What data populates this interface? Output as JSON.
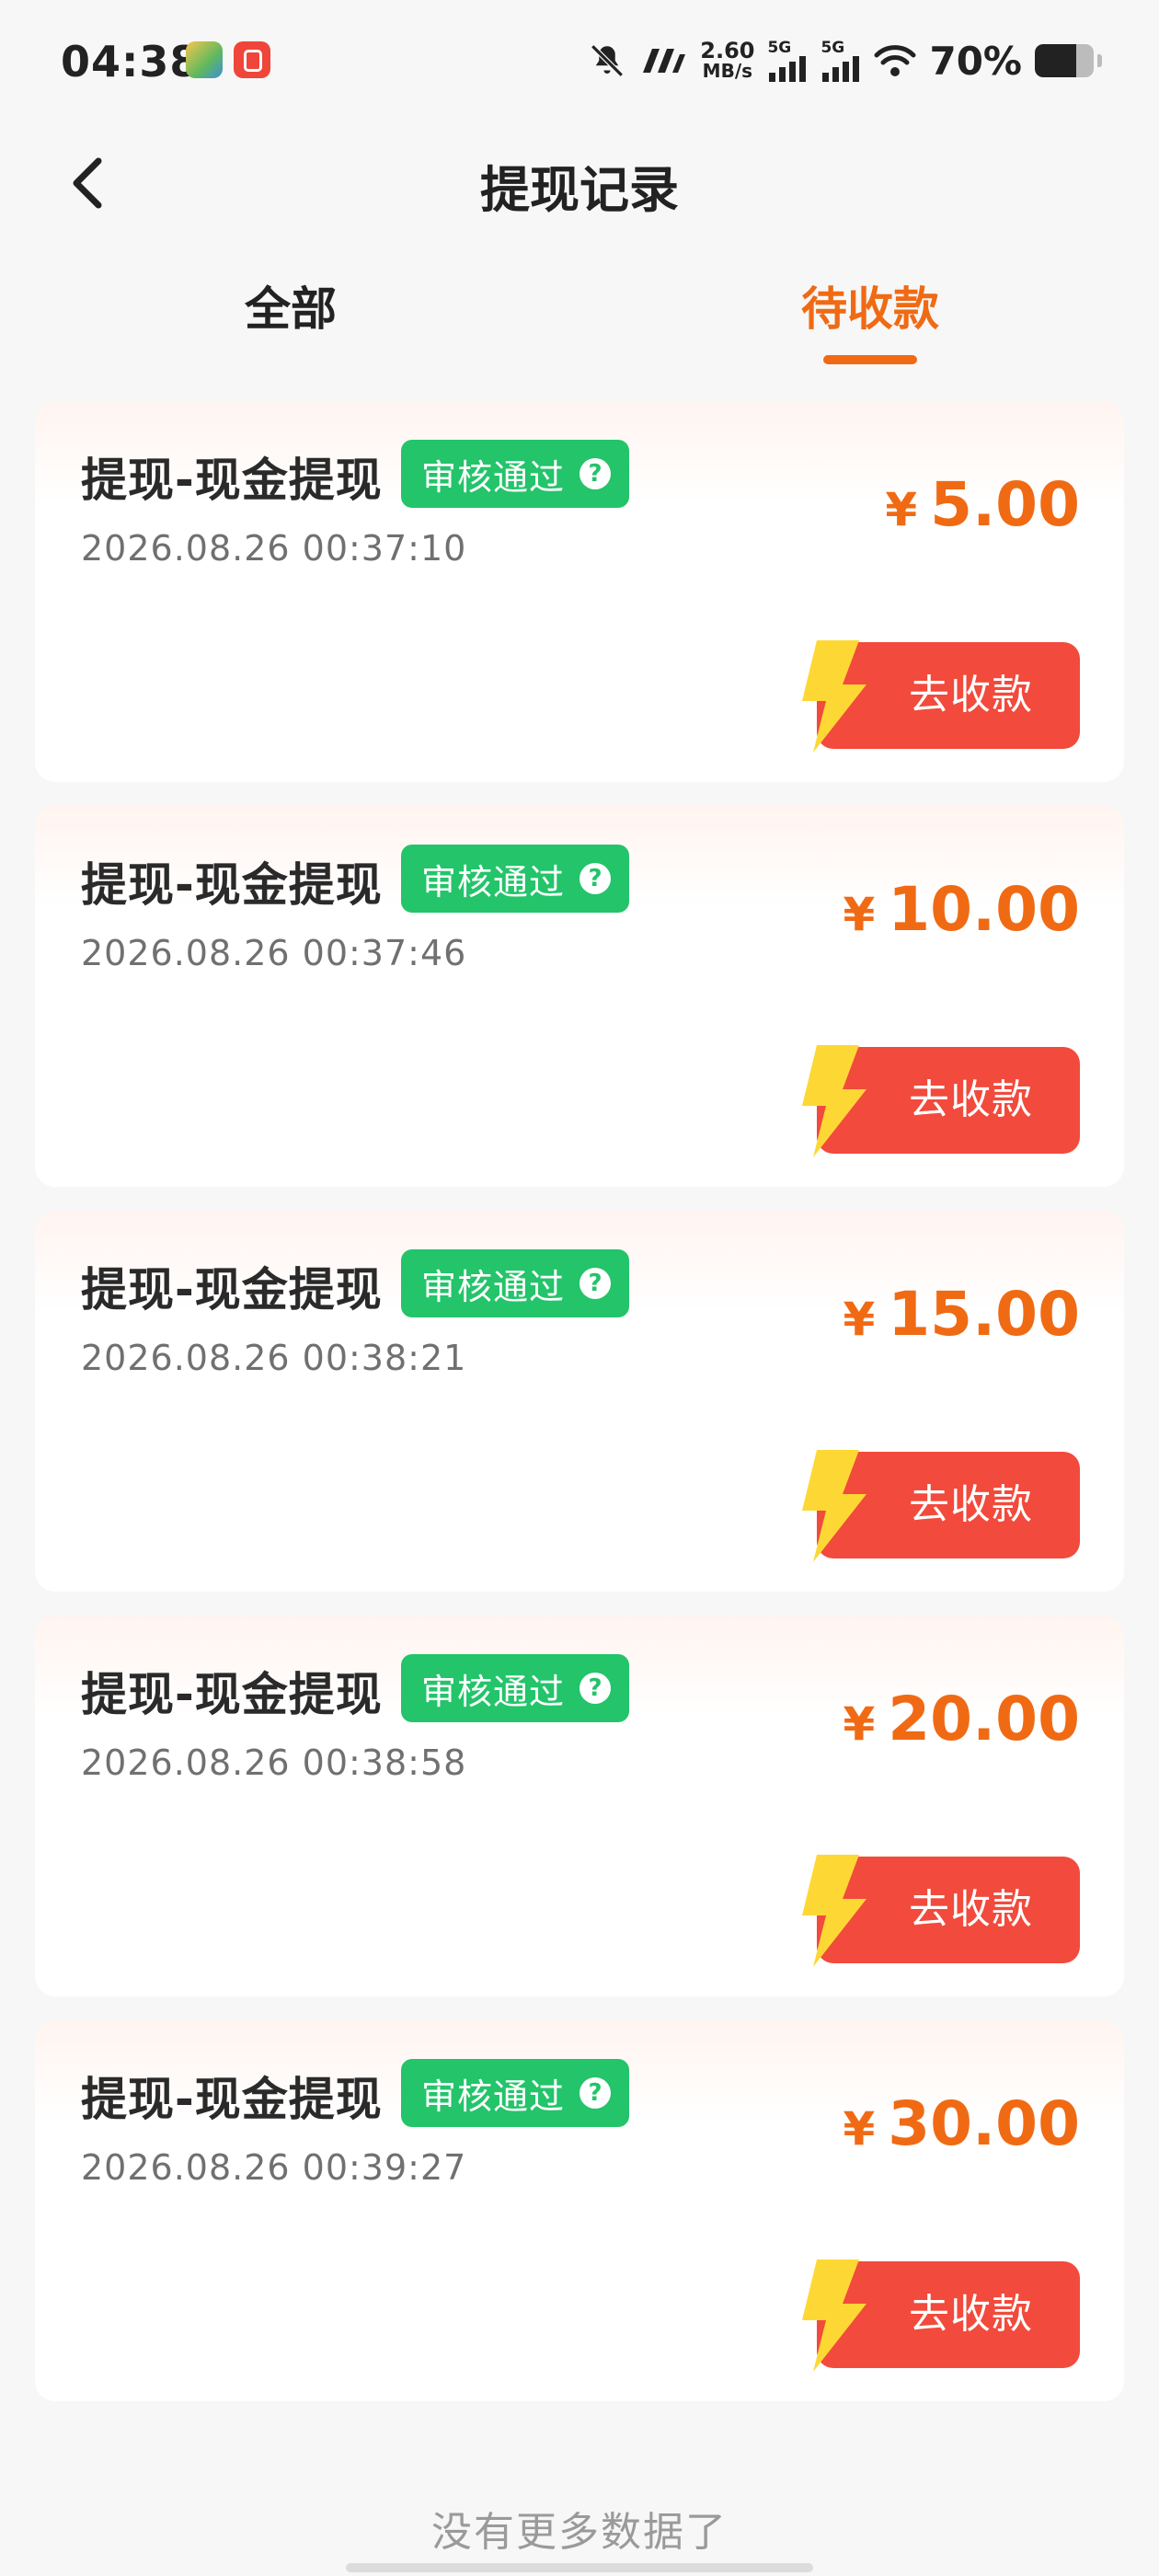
{
  "status_bar": {
    "time": "04:38",
    "net_speed_value": "2.60",
    "net_speed_unit": "MB/s",
    "network_1": "5G",
    "network_2": "5G",
    "battery_percent_text": "70%",
    "battery_level": 0.7
  },
  "header": {
    "title": "提现记录"
  },
  "tabs": [
    {
      "label": "全部",
      "active": false
    },
    {
      "label": "待收款",
      "active": true
    }
  ],
  "records": [
    {
      "title": "提现-现金提现",
      "status": "审核通过",
      "time": "2026.08.26 00:37:10",
      "currency": "¥",
      "amount": "5.00",
      "action": "去收款"
    },
    {
      "title": "提现-现金提现",
      "status": "审核通过",
      "time": "2026.08.26 00:37:46",
      "currency": "¥",
      "amount": "10.00",
      "action": "去收款"
    },
    {
      "title": "提现-现金提现",
      "status": "审核通过",
      "time": "2026.08.26 00:38:21",
      "currency": "¥",
      "amount": "15.00",
      "action": "去收款"
    },
    {
      "title": "提现-现金提现",
      "status": "审核通过",
      "time": "2026.08.26 00:38:58",
      "currency": "¥",
      "amount": "20.00",
      "action": "去收款"
    },
    {
      "title": "提现-现金提现",
      "status": "审核通过",
      "time": "2026.08.26 00:39:27",
      "currency": "¥",
      "amount": "30.00",
      "action": "去收款"
    }
  ],
  "footer": {
    "no_more_text": "没有更多数据了"
  },
  "colors": {
    "accent": "#f06a14",
    "badge_green": "#23c46a",
    "button_red": "#f24a3c",
    "lightning_yellow": "#fdd835"
  },
  "icons": {
    "back": "chevron-left-icon",
    "badge_help": "question-icon",
    "button": "lightning-icon",
    "status_bell": "bell-off-icon"
  }
}
